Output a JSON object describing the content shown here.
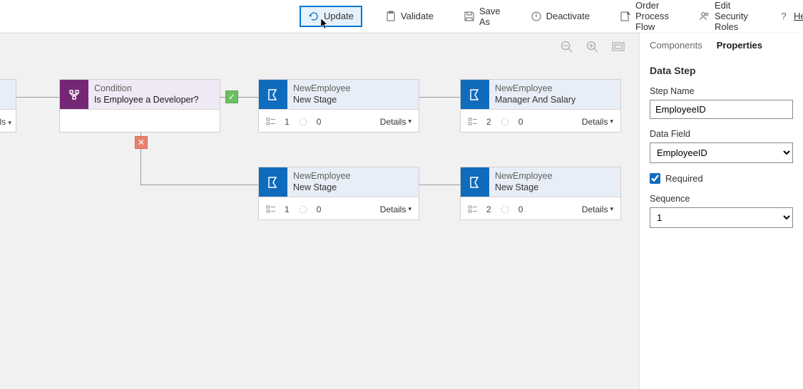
{
  "toolbar": {
    "update": "Update",
    "validate": "Validate",
    "saveas": "Save As",
    "deactivate": "Deactivate",
    "order": "Order Process Flow",
    "security": "Edit Security Roles",
    "help": "Help"
  },
  "condition": {
    "label": "Condition",
    "question": "Is Employee a Developer?"
  },
  "startNode": {
    "detailsLabel": "ls"
  },
  "stages": {
    "s1": {
      "entity": "NewEmployee",
      "name": "New Stage",
      "steps": "1",
      "proc": "0",
      "details": "Details"
    },
    "s2": {
      "entity": "NewEmployee",
      "name": "Manager And Salary",
      "steps": "2",
      "proc": "0",
      "details": "Details"
    },
    "s3": {
      "entity": "NewEmployee",
      "name": "New Stage",
      "steps": "1",
      "proc": "0",
      "details": "Details"
    },
    "s4": {
      "entity": "NewEmployee",
      "name": "New Stage",
      "steps": "2",
      "proc": "0",
      "details": "Details"
    }
  },
  "panel": {
    "tabComponents": "Components",
    "tabProperties": "Properties",
    "sectionTitle": "Data Step",
    "stepNameLabel": "Step Name",
    "stepNameValue": "EmployeeID",
    "dataFieldLabel": "Data Field",
    "dataFieldValue": "EmployeeID",
    "requiredLabel": "Required",
    "sequenceLabel": "Sequence",
    "sequenceValue": "1"
  }
}
